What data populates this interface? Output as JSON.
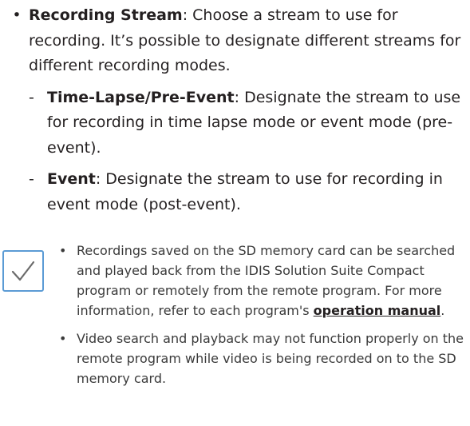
{
  "colors": {
    "text": "#231f20",
    "note_text": "#3a3a3a",
    "checkbox_border": "#5b9bd5",
    "checkmark": "#6b6b6b"
  },
  "recording_stream": {
    "bullet": "•",
    "label": "Recording Stream",
    "description": ": Choose a stream to use for recording. It’s possible to designate different streams for different recording modes.",
    "sub_items": [
      {
        "dash": "-",
        "label": "Time-Lapse/Pre-Event",
        "description": ": Designate the stream to use for recording in time lapse mode or event mode (pre-event)."
      },
      {
        "dash": "-",
        "label": "Event",
        "description": ": Designate the stream to use for recording in event mode (post-event)."
      }
    ]
  },
  "note": {
    "icon": "checkmark-icon",
    "items": [
      {
        "bullet": "•",
        "text_before": "Recordings saved on the SD memory card can be searched and played back from the IDIS Solution Suite Compact program or remotely from the remote program. For more information, refer to each program's ",
        "link": "operation manual",
        "text_after": "."
      },
      {
        "bullet": "•",
        "text": "Video search and playback may not function properly on the remote program while video is being recorded on to the SD memory card."
      }
    ]
  }
}
